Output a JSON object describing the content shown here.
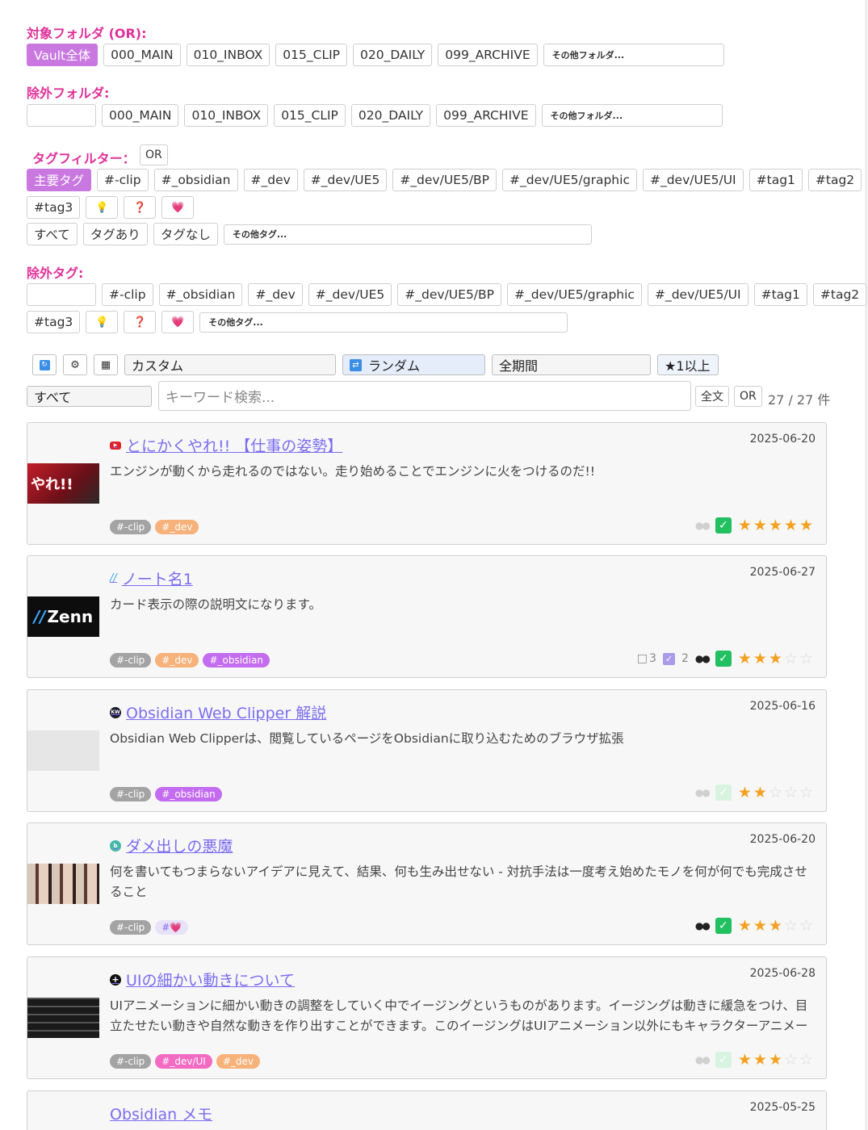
{
  "colors": {
    "accent": "#e0319a",
    "active_chip": "#c978e0",
    "link": "#7b6cf0",
    "star": "#f4a020",
    "check": "#22c060"
  },
  "target_folders": {
    "title": "対象フォルダ (OR):",
    "items": [
      "Vault全体",
      "000_MAIN",
      "010_INBOX",
      "015_CLIP",
      "020_DAILY",
      "099_ARCHIVE"
    ],
    "other": "その他フォルダ..."
  },
  "exclude_folders": {
    "title": "除外フォルダ:",
    "items": [
      "000_MAIN",
      "010_INBOX",
      "015_CLIP",
      "020_DAILY",
      "099_ARCHIVE"
    ],
    "other": "その他フォルダ..."
  },
  "tag_filter": {
    "title": "タグフィルター：",
    "mode": "OR",
    "items": [
      "主要タグ",
      "#-clip",
      "#_obsidian",
      "#_dev",
      "#_dev/UE5",
      "#_dev/UE5/BP",
      "#_dev/UE5/graphic",
      "#_dev/UE5/UI",
      "#tag1",
      "#tag2",
      "#tag3",
      "💡",
      "❓",
      "💗"
    ],
    "status": [
      "すべて",
      "タグあり",
      "タグなし"
    ],
    "other": "その他タグ..."
  },
  "exclude_tags": {
    "title": "除外タグ:",
    "items": [
      "#-clip",
      "#_obsidian",
      "#_dev",
      "#_dev/UE5",
      "#_dev/UE5/BP",
      "#_dev/UE5/graphic",
      "#_dev/UE5/UI",
      "#tag1",
      "#tag2",
      "#tag3",
      "💡",
      "❓",
      "💗"
    ],
    "other": "その他タグ..."
  },
  "toolbar": {
    "sort_custom": "カスタム",
    "sort_random": "ランダム",
    "period": "全期間",
    "rating": "★1以上",
    "scope": "すべて",
    "search_placeholder": "キーワード検索...",
    "fulltext": "全文",
    "mode": "OR",
    "count": "27 / 27 件"
  },
  "cards": [
    {
      "title": "とにかくやれ!! 【仕事の姿勢】",
      "source": "youtube-icon",
      "date": "2025-06-20",
      "desc": "エンジンが動くから走れるのではない。走り始めることでエンジンに火をつけるのだ!!",
      "tags": [
        "#-clip",
        "#_dev"
      ],
      "tasks": "",
      "done": "",
      "eyes": "dim",
      "checked": true,
      "rating": 5,
      "thumb": "やれ!!"
    },
    {
      "title": "ノート名1",
      "source": "zenn-icon",
      "date": "2025-06-27",
      "desc": "カード表示の際の説明文になります。",
      "tags": [
        "#-clip",
        "#_dev",
        "#_obsidian"
      ],
      "tasks": "3",
      "done": "2",
      "eyes": "on",
      "checked": true,
      "rating": 3,
      "thumb": "Zenn"
    },
    {
      "title": "Obsidian Web Clipper 解説",
      "source": "web-icon",
      "date": "2025-06-16",
      "desc": "Obsidian Web Clipperは、閲覧しているページをObsidianに取り込むためのブラウザ拡張",
      "tags": [
        "#-clip",
        "#_obsidian"
      ],
      "tasks": "",
      "done": "",
      "eyes": "dim",
      "checked": false,
      "rating": 2,
      "thumb": ""
    },
    {
      "title": "ダメ出しの悪魔",
      "source": "blog-icon",
      "date": "2025-06-20",
      "desc": "何を書いてもつまらないアイデアに見えて、結果、何も生み出せない - 対抗手法は一度考え始めたモノを何が何でも完成させること",
      "tags": [
        "#-clip",
        "#💗"
      ],
      "tasks": "",
      "done": "",
      "eyes": "on",
      "checked": true,
      "rating": 3,
      "thumb": ""
    },
    {
      "title": "UIの細かい動きについて",
      "source": "plus-icon",
      "date": "2025-06-28",
      "desc": "UIアニメーションに細かい動きの調整をしていく中でイージングというものがあります。イージングは動きに緩急をつけ、目立たせたい動きや自然な動きを作り出すことができます。このイージングはUIアニメーション以外にもキャラクターアニメーションやエフェクト",
      "tags": [
        "#-clip",
        "#_dev/UI",
        "#_dev"
      ],
      "tasks": "",
      "done": "",
      "eyes": "dim",
      "checked": false,
      "rating": 3,
      "thumb": ""
    },
    {
      "title": "Obsidian メモ",
      "source": "",
      "date": "2025-05-25",
      "desc": "",
      "tags": [],
      "tasks": "",
      "done": "",
      "eyes": "dim",
      "checked": false,
      "rating": 0,
      "thumb": ""
    }
  ]
}
